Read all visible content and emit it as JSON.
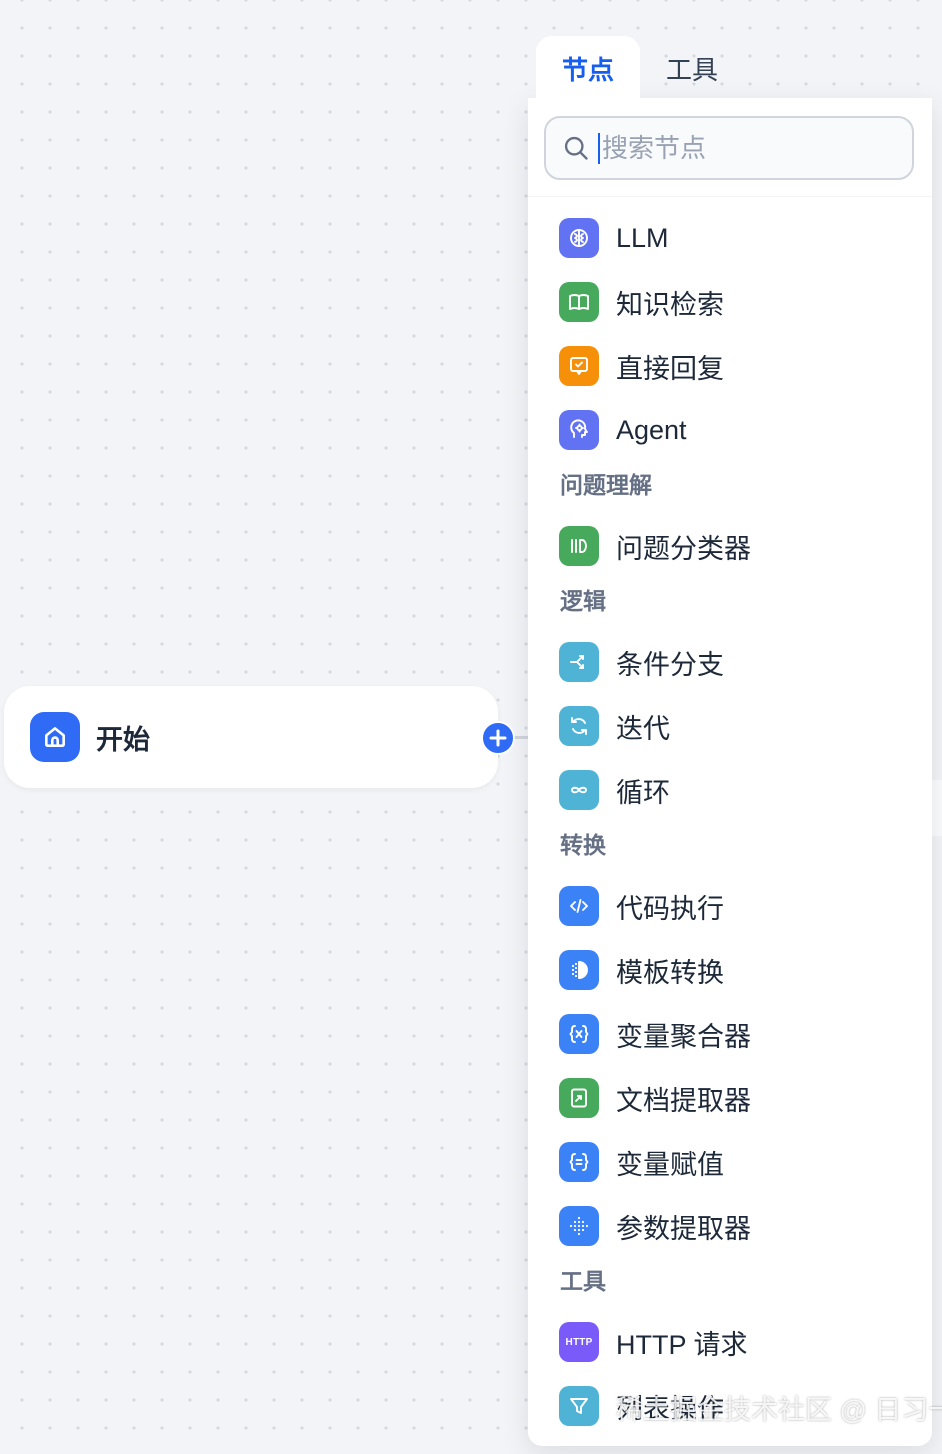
{
  "canvas": {
    "start_node": {
      "label": "开始"
    }
  },
  "panel": {
    "tabs": [
      {
        "label": "节点",
        "active": true
      },
      {
        "label": "工具",
        "active": false
      }
    ],
    "search": {
      "placeholder": "搜索节点",
      "value": ""
    },
    "items": [
      {
        "type": "item",
        "label": "LLM",
        "icon": "brain-icon",
        "color": "#6172f3"
      },
      {
        "type": "item",
        "label": "知识检索",
        "icon": "book-icon",
        "color": "#47a95c"
      },
      {
        "type": "item",
        "label": "直接回复",
        "icon": "reply-icon",
        "color": "#f79009"
      },
      {
        "type": "item",
        "label": "Agent",
        "icon": "agent-icon",
        "color": "#6172f3"
      },
      {
        "type": "section",
        "label": "问题理解"
      },
      {
        "type": "item",
        "label": "问题分类器",
        "icon": "classifier-icon",
        "color": "#47a95c"
      },
      {
        "type": "section",
        "label": "逻辑"
      },
      {
        "type": "item",
        "label": "条件分支",
        "icon": "branch-icon",
        "color": "#4fb3d6"
      },
      {
        "type": "item",
        "label": "迭代",
        "icon": "iteration-icon",
        "color": "#4fb3d6"
      },
      {
        "type": "item",
        "label": "循环",
        "icon": "loop-icon",
        "color": "#4fb3d6"
      },
      {
        "type": "section",
        "label": "转换"
      },
      {
        "type": "item",
        "label": "代码执行",
        "icon": "code-icon",
        "color": "#3b82f6"
      },
      {
        "type": "item",
        "label": "模板转换",
        "icon": "template-icon",
        "color": "#3b82f6"
      },
      {
        "type": "item",
        "label": "变量聚合器",
        "icon": "variable-aggregator-icon",
        "color": "#3b82f6"
      },
      {
        "type": "item",
        "label": "文档提取器",
        "icon": "document-extractor-icon",
        "color": "#47a95c"
      },
      {
        "type": "item",
        "label": "变量赋值",
        "icon": "variable-assign-icon",
        "color": "#3b82f6"
      },
      {
        "type": "item",
        "label": "参数提取器",
        "icon": "parameter-extractor-icon",
        "color": "#3b82f6"
      },
      {
        "type": "section",
        "label": "工具"
      },
      {
        "type": "item",
        "label": "HTTP 请求",
        "icon": "http-icon",
        "color": "#7a5af8",
        "icon_text": "HTTP"
      },
      {
        "type": "item",
        "label": "列表操作",
        "icon": "filter-icon",
        "color": "#4fb3d6"
      }
    ]
  },
  "watermark": "稀土掘金技术社区 @ 日习一技"
}
